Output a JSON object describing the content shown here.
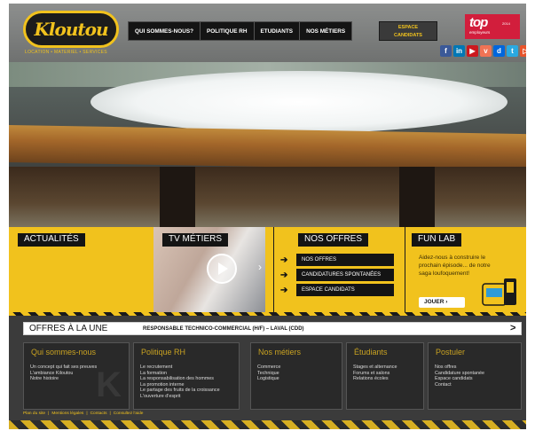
{
  "brand": {
    "logo_text": "Kloutou",
    "tagline": "LOCATION • MATERIEL • SERVICES",
    "accent_color": "#f1c21d"
  },
  "nav": {
    "items": [
      {
        "label": "QUI SOMMES-NOUS?"
      },
      {
        "label": "POLITIQUE RH"
      },
      {
        "label": "ETUDIANTS"
      },
      {
        "label": "NOS MÉTIERS"
      }
    ],
    "espace_line1": "ESPACE",
    "espace_line2": "CANDIDATS"
  },
  "badge": {
    "big": "top",
    "small": "employeurs",
    "year": "2014",
    "color": "#d21e3c"
  },
  "social": [
    {
      "icon": "facebook-icon",
      "glyph": "f",
      "color": "#3b5998"
    },
    {
      "icon": "linkedin-icon",
      "glyph": "in",
      "color": "#0077b5"
    },
    {
      "icon": "youtube-icon",
      "glyph": "▶",
      "color": "#cc181e"
    },
    {
      "icon": "viadeo-icon",
      "glyph": "v",
      "color": "#f07355"
    },
    {
      "icon": "dailymotion-icon",
      "glyph": "d",
      "color": "#0066dc"
    },
    {
      "icon": "twitter-icon",
      "glyph": "t",
      "color": "#2aa9e0"
    },
    {
      "icon": "play-store-icon",
      "glyph": "▷",
      "color": "#e8542b"
    }
  ],
  "carousel": {
    "slides": 4,
    "active": 1
  },
  "panels": {
    "actualites": {
      "title": "ACTUALITÉS"
    },
    "tv": {
      "title": "TV MÉTIERS"
    },
    "offres": {
      "title": "NOS OFFRES",
      "links": [
        {
          "label": "NOS OFFRES"
        },
        {
          "label": "CANDIDATURES SPONTANÉES"
        },
        {
          "label": "ESPACE CANDIDATS"
        }
      ]
    },
    "funlab": {
      "title": "FUN LAB",
      "text": "Aidez-nous à construire le prochain épisode... de notre saga loufoquement!",
      "cta": "JOUER ›"
    }
  },
  "une": {
    "title": "OFFRES À LA UNE",
    "job": "RESPONSABLE TECHNICO-COMMERCIAL (H/F) – LAVAL (CDD)",
    "arrow": ">"
  },
  "columns": [
    {
      "title": "Qui sommes-nous",
      "items": [
        "Un concept qui fait ses preuves",
        "L'ambiance Kiloutou",
        "Notre histoire"
      ]
    },
    {
      "title": "Politique RH",
      "items": [
        "Le recrutement",
        "La formation",
        "La responsabilisation des hommes",
        "La promotion interne",
        "Le partage des fruits de la croissance",
        "L'ouverture d'esprit"
      ]
    },
    {
      "title": "Nos métiers",
      "items": [
        "Commerce",
        "Technique",
        "Logistique"
      ]
    },
    {
      "title": "Étudiants",
      "items": [
        "Stages et alternance",
        "Forums et salons",
        "Relations écoles"
      ]
    },
    {
      "title": "Postuler",
      "items": [
        "Nos offres",
        "Candidature spontanée",
        "Espace candidats",
        "Contact"
      ]
    }
  ],
  "footer": {
    "links": [
      {
        "label": "Plan du site"
      },
      {
        "label": "Mentions légales"
      },
      {
        "label": "Contacts"
      },
      {
        "label": "Consultez l'aide"
      }
    ]
  }
}
